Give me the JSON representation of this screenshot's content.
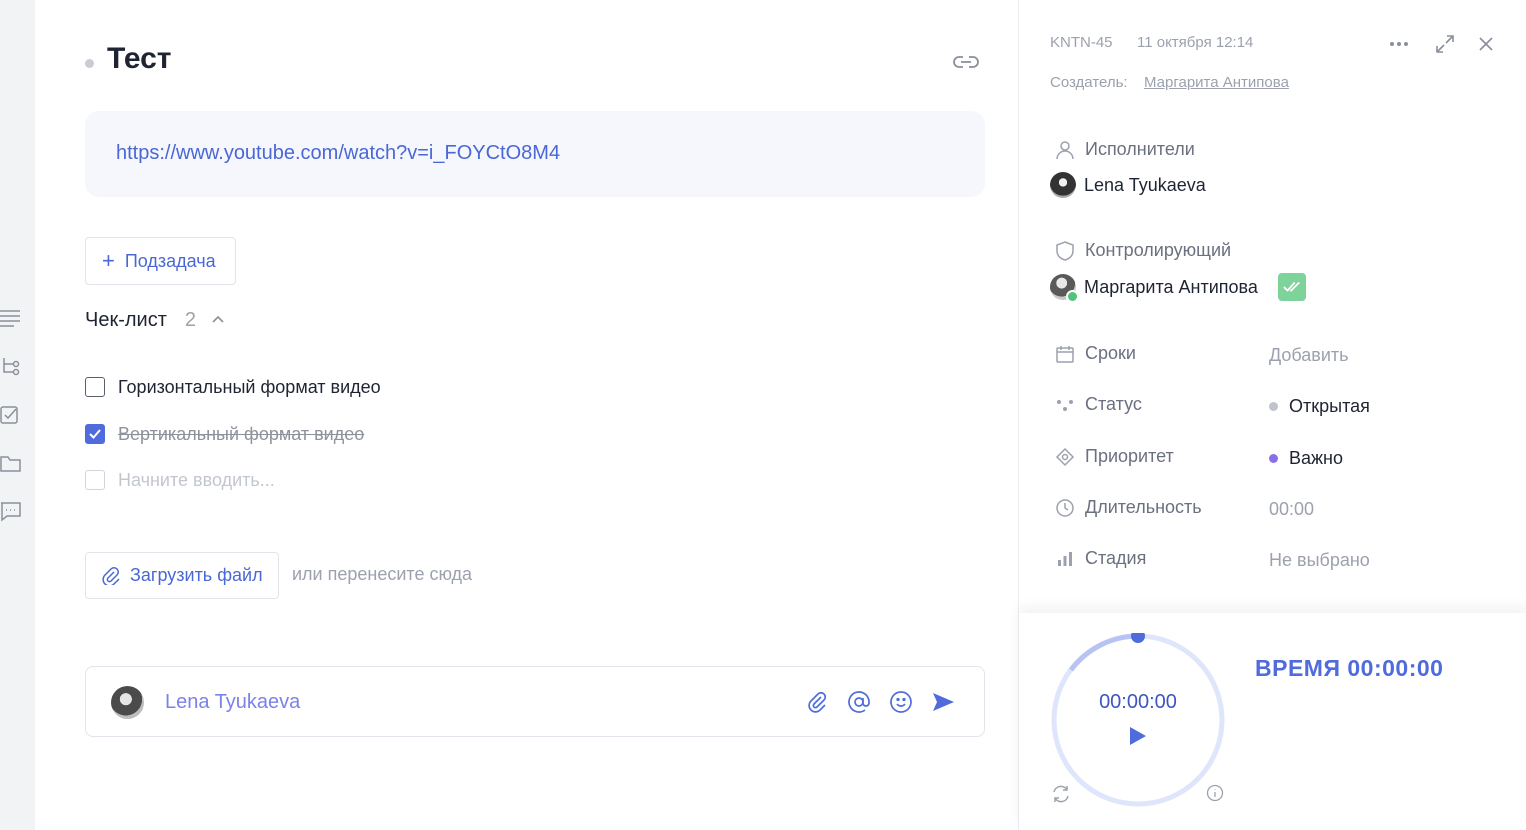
{
  "task": {
    "title": "Тест",
    "description_link": "https://www.youtube.com/watch?v=i_FOYCtO8M4",
    "subtask_label": "Подзадача",
    "checklist": {
      "title": "Чек-лист",
      "count": "2",
      "items": [
        {
          "text": "Горизонтальный формат видео",
          "checked": false
        },
        {
          "text": "Вертикальный формат видео",
          "checked": true
        }
      ],
      "placeholder": "Начните вводить..."
    },
    "upload_label": "Загрузить файл",
    "upload_hint": "или перенесите сюда",
    "comment_author": "Lena Tyukaeva"
  },
  "sidebar": {
    "task_id": "KNTN-45",
    "date": "11 октября 12:14",
    "creator_label": "Создатель:",
    "creator_name": "Маргарита Антипова",
    "assignees_label": "Исполнители",
    "assignee": "Lena Tyukaeva",
    "controller_label": "Контролирующий",
    "controller": "Маргарита Антипова",
    "props": {
      "deadline_label": "Сроки",
      "deadline_value": "Добавить",
      "status_label": "Статус",
      "status_value": "Открытая",
      "priority_label": "Приоритет",
      "priority_value": "Важно",
      "duration_label": "Длительность",
      "duration_value": "00:00",
      "stage_label": "Стадия",
      "stage_value": "Не выбрано"
    }
  },
  "timer": {
    "display": "00:00:00",
    "total": "ВРЕМЯ 00:00:00"
  },
  "colors": {
    "accent": "#4f6bdc",
    "status_dot": "#bfc3cb",
    "priority_dot": "#8b6fe8",
    "check_green": "#7ed39a"
  },
  "icons": {
    "rail": [
      "description-icon",
      "subtasks-icon",
      "checklist-icon",
      "folder-icon",
      "comments-icon"
    ],
    "top": [
      "more-icon",
      "expand-icon",
      "close-icon"
    ],
    "comment": [
      "attach-icon",
      "mention-icon",
      "emoji-icon",
      "send-icon"
    ]
  }
}
